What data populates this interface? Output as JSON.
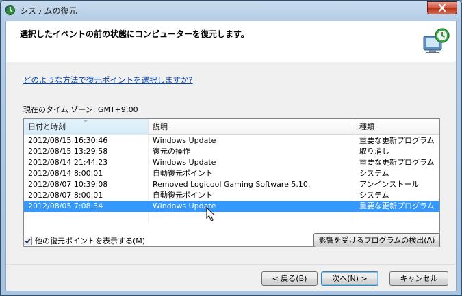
{
  "window": {
    "title": "システムの復元"
  },
  "header": {
    "instruction": "選択したイベントの前の状態にコンピューターを復元します。"
  },
  "help_link": "どのような方法で復元ポイントを選択しますか?",
  "timezone_label": "現在のタイム ゾーン: GMT+9:00",
  "table": {
    "columns": [
      "日付と時刻",
      "説明",
      "種類"
    ],
    "rows": [
      {
        "date": "2012/08/15 16:30:46",
        "desc": "Windows Update",
        "type": "重要な更新プログラム"
      },
      {
        "date": "2012/08/15 13:29:58",
        "desc": "復元の操作",
        "type": "取り消し"
      },
      {
        "date": "2012/08/14 21:44:23",
        "desc": "Windows Update",
        "type": "重要な更新プログラム"
      },
      {
        "date": "2012/08/14 8:00:01",
        "desc": "自動復元ポイント",
        "type": "システム"
      },
      {
        "date": "2012/08/07 10:39:08",
        "desc": "Removed Logicool Gaming Software 5.10.",
        "type": "アンインストール"
      },
      {
        "date": "2012/08/07 8:00:01",
        "desc": "自動復元ポイント",
        "type": "システム"
      },
      {
        "date": "2012/08/05 7:08:34",
        "desc": "Windows Update",
        "type": "重要な更新プログラム"
      }
    ],
    "selected_row": 6
  },
  "show_more_checkbox": {
    "label": "他の復元ポイントを表示する(M)",
    "checked": true
  },
  "buttons": {
    "scan": "影響を受けるプログラムの検出(A)",
    "back": "< 戻る(B)",
    "next": "次へ(N) >",
    "cancel": "キャンセル"
  },
  "colors": {
    "selection": "#3399ff",
    "link": "#0645ad",
    "close_button": "#c8452c"
  },
  "icons": {
    "title": "system-restore-icon",
    "header": "computer-restore-clock-icon",
    "close": "close-icon",
    "checkbox": "check-icon",
    "cursor": "mouse-cursor-icon"
  }
}
